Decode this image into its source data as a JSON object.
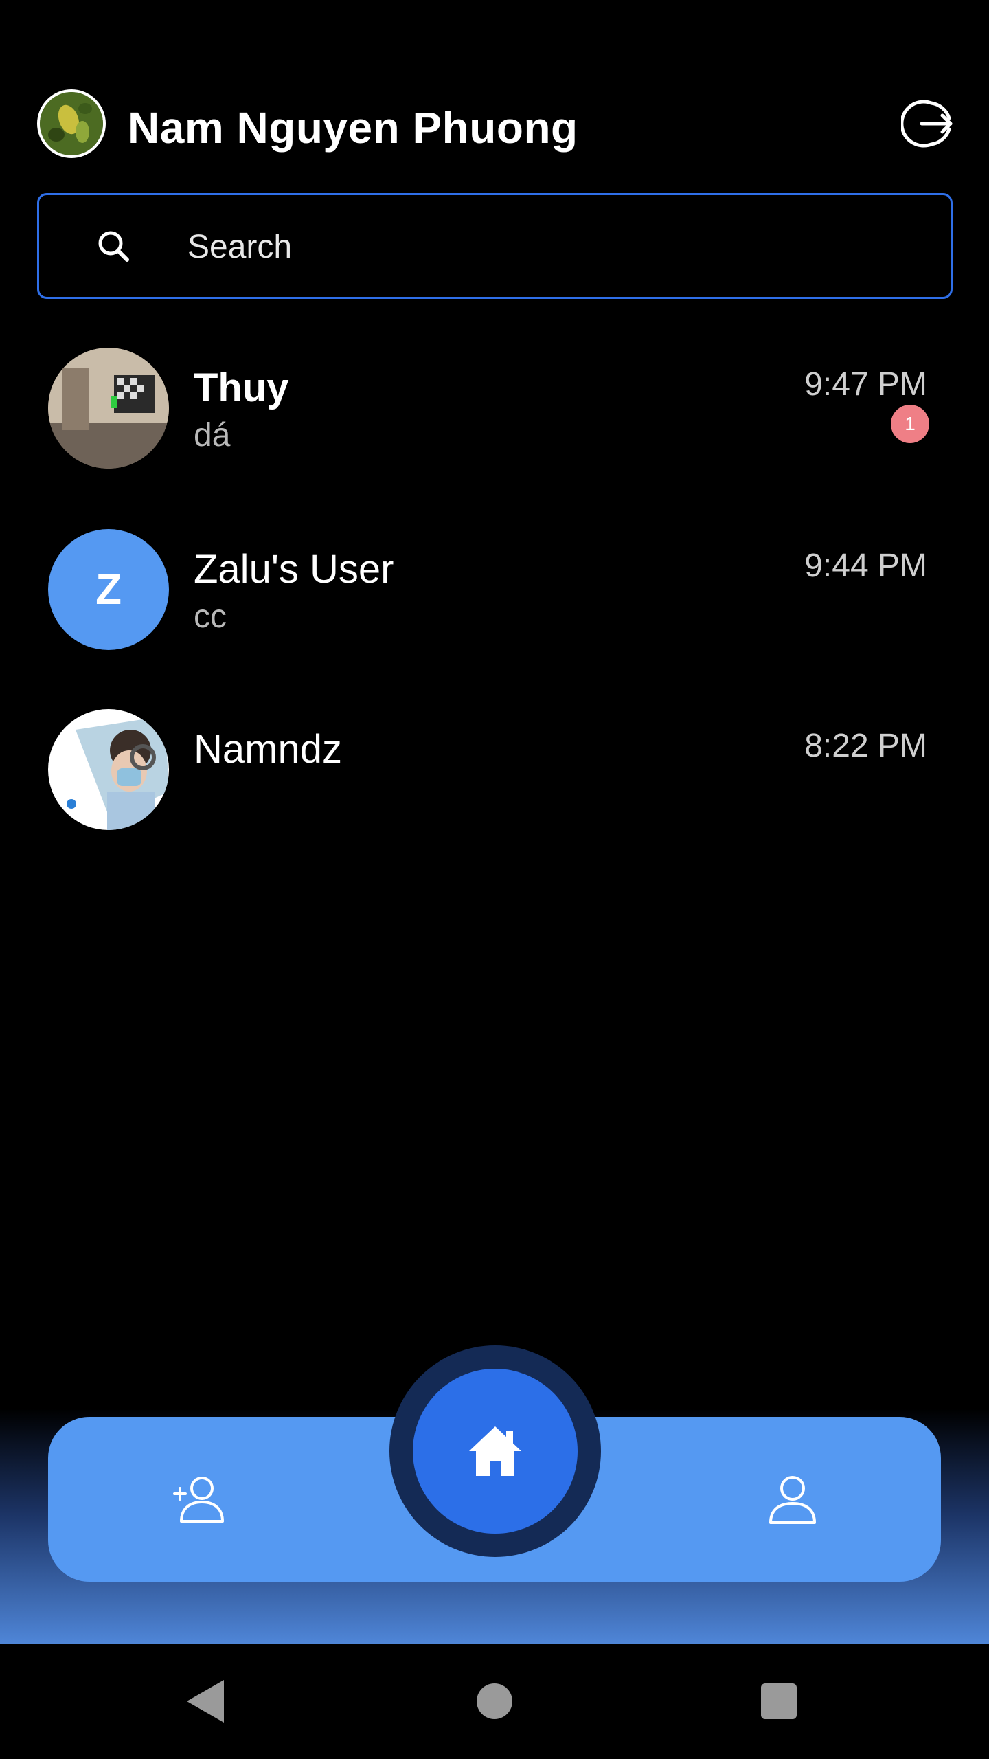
{
  "header": {
    "user_name": "Nam Nguyen Phuong",
    "avatar_icon": "profile-photo",
    "logout_icon": "logout-icon"
  },
  "search": {
    "placeholder": "Search",
    "value": "",
    "border_color": "#2f6fe8"
  },
  "conversations": [
    {
      "name": "Thuy",
      "preview": "dá",
      "time": "9:47 PM",
      "unread_count": "1",
      "unread": true,
      "avatar": "photo"
    },
    {
      "name": "Zalu's User",
      "preview": "cc",
      "time": "9:44 PM",
      "unread": false,
      "avatar_letter": "Z",
      "avatar_color": "#5599f2"
    },
    {
      "name": "Namndz",
      "preview": "",
      "time": "8:22 PM",
      "unread": false,
      "avatar": "photo"
    }
  ],
  "bottom_nav": {
    "left_icon": "add-friend-icon",
    "center_icon": "home-icon",
    "right_icon": "profile-icon",
    "pill_color": "#5599f2",
    "home_color": "#2c6fe8"
  },
  "system_nav": {
    "back_icon": "back-icon",
    "home_icon": "home-circle-icon",
    "recents_icon": "recents-icon"
  },
  "colors": {
    "background": "#000000",
    "badge": "#ef7f86",
    "accent": "#2f6fe8"
  }
}
